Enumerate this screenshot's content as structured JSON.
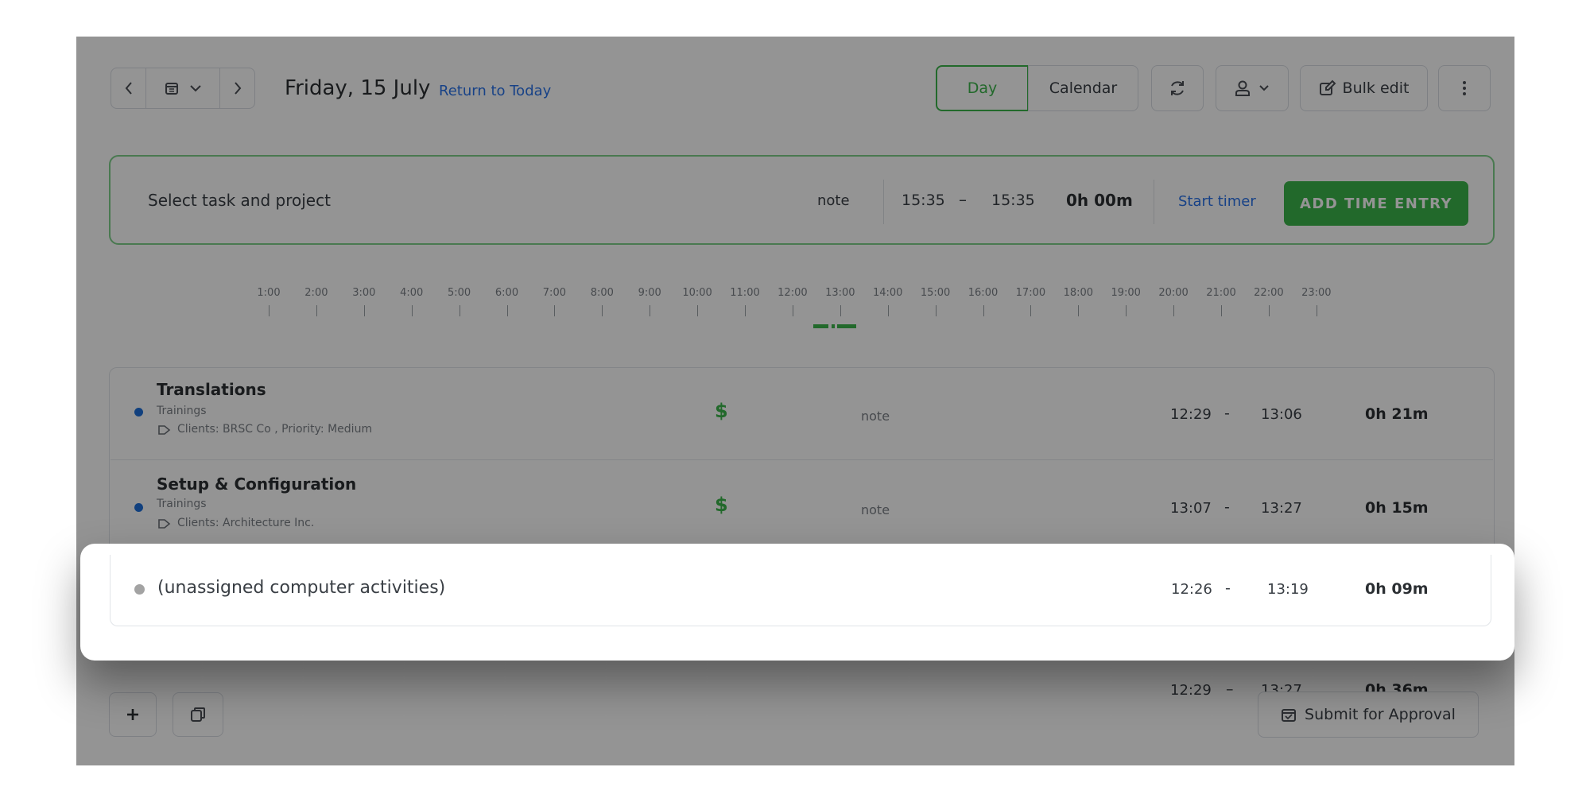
{
  "header": {
    "date_title": "Friday, 15 July",
    "return_link": "Return to Today",
    "view_day": "Day",
    "view_calendar": "Calendar",
    "bulk_edit": "Bulk edit"
  },
  "entry_bar": {
    "task_placeholder": "Select task and project",
    "note": "note",
    "start": "15:35",
    "dash": "–",
    "end": "15:35",
    "duration": "0h 00m",
    "start_timer": "Start timer",
    "add_button": "ADD TIME ENTRY"
  },
  "timeline": {
    "hours": [
      "1:00",
      "2:00",
      "3:00",
      "4:00",
      "5:00",
      "6:00",
      "7:00",
      "8:00",
      "9:00",
      "10:00",
      "11:00",
      "12:00",
      "13:00",
      "14:00",
      "15:00",
      "16:00",
      "17:00",
      "18:00",
      "19:00",
      "20:00",
      "21:00",
      "22:00",
      "23:00"
    ]
  },
  "entries": [
    {
      "task": "Translations",
      "project": "Trainings",
      "tags": "Clients: BRSC Co , Priority: Medium",
      "note": "note",
      "start": "12:29",
      "dash": "-",
      "end": "13:06",
      "duration": "0h 21m",
      "color": "#1e6fd9"
    },
    {
      "task": "Setup & Configuration",
      "project": "Trainings",
      "tags": "Clients: Architecture Inc.",
      "note": "note",
      "start": "13:07",
      "dash": "-",
      "end": "13:27",
      "duration": "0h 15m",
      "color": "#1e6fd9"
    }
  ],
  "unassigned": {
    "label": "(unassigned computer activities)",
    "start": "12:26",
    "dash": "-",
    "end": "13:19",
    "duration": "0h 09m",
    "color": "#a3a3a3"
  },
  "total_partial": {
    "start": "12:29",
    "dash": "–",
    "end": "13:27",
    "duration": "0h 36m"
  },
  "footer": {
    "submit": "Submit for Approval"
  },
  "colors": {
    "accent_green": "#3bb54a",
    "link_blue": "#2a73e8",
    "dot_blue": "#1e6fd9"
  }
}
